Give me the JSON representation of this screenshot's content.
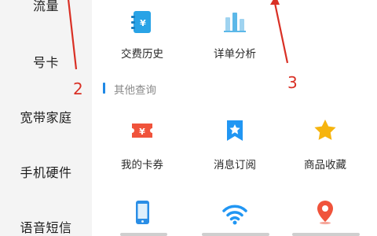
{
  "sidebar": {
    "items": [
      {
        "label": "流量"
      },
      {
        "label": "号卡"
      },
      {
        "label": "宽带家庭"
      },
      {
        "label": "手机硬件"
      },
      {
        "label": "语音短信"
      }
    ]
  },
  "main": {
    "top_row": [
      {
        "label": "交费历史",
        "icon": "bill-history-icon",
        "color": "#29a3e6"
      },
      {
        "label": "详单分析",
        "icon": "bar-chart-icon",
        "color": "#5cb8e8"
      }
    ],
    "section": {
      "title": "其他查询",
      "accent": "#1e88e5"
    },
    "other_row": [
      {
        "label": "我的卡券",
        "icon": "coupon-icon",
        "color": "#f0533b"
      },
      {
        "label": "消息订阅",
        "icon": "bookmark-star-icon",
        "color": "#2196f3"
      },
      {
        "label": "商品收藏",
        "icon": "star-icon",
        "color": "#f6b40e"
      }
    ],
    "bottom_row": [
      {
        "icon": "phone-icon",
        "color": "#2a8ee6"
      },
      {
        "icon": "wifi-icon",
        "color": "#2196f3"
      },
      {
        "icon": "location-pin-icon",
        "color": "#f0533b"
      }
    ]
  },
  "annotations": {
    "labels": [
      "2",
      "3"
    ],
    "color": "#d93025"
  }
}
